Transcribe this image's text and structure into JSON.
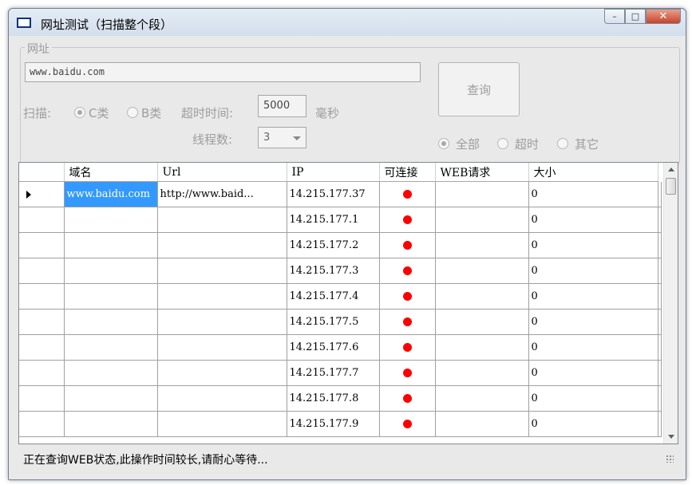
{
  "window": {
    "title": "网址测试（扫描整个段）",
    "buttons": {
      "minimize": "–",
      "maximize": "□",
      "close": "✕"
    }
  },
  "form": {
    "legend": "网址",
    "url_value": "www.baidu.com",
    "scan_label": "扫描:",
    "scan_options": [
      "C类",
      "B类"
    ],
    "scan_selected": "C类",
    "timeout_label": "超时时间:",
    "timeout_value": "5000",
    "timeout_unit": "毫秒",
    "threads_label": "线程数:",
    "threads_value": "3",
    "query_button": "查询",
    "filter_options": [
      "全部",
      "超时",
      "其它"
    ],
    "filter_selected": "全部"
  },
  "grid": {
    "columns": [
      "域名",
      "Url",
      "IP",
      "可连接",
      "WEB请求",
      "大小"
    ],
    "rows": [
      {
        "domain": "www.baidu.com",
        "url": "http://www.baid...",
        "ip": "14.215.177.37",
        "connectable": "red-dot",
        "web": "",
        "size": "0"
      },
      {
        "domain": "",
        "url": "",
        "ip": "14.215.177.1",
        "connectable": "red-dot",
        "web": "",
        "size": "0"
      },
      {
        "domain": "",
        "url": "",
        "ip": "14.215.177.2",
        "connectable": "red-dot",
        "web": "",
        "size": "0"
      },
      {
        "domain": "",
        "url": "",
        "ip": "14.215.177.3",
        "connectable": "red-dot",
        "web": "",
        "size": "0"
      },
      {
        "domain": "",
        "url": "",
        "ip": "14.215.177.4",
        "connectable": "red-dot",
        "web": "",
        "size": "0"
      },
      {
        "domain": "",
        "url": "",
        "ip": "14.215.177.5",
        "connectable": "red-dot",
        "web": "",
        "size": "0"
      },
      {
        "domain": "",
        "url": "",
        "ip": "14.215.177.6",
        "connectable": "red-dot",
        "web": "",
        "size": "0"
      },
      {
        "domain": "",
        "url": "",
        "ip": "14.215.177.7",
        "connectable": "red-dot",
        "web": "",
        "size": "0"
      },
      {
        "domain": "",
        "url": "",
        "ip": "14.215.177.8",
        "connectable": "red-dot",
        "web": "",
        "size": "0"
      },
      {
        "domain": "",
        "url": "",
        "ip": "14.215.177.9",
        "connectable": "red-dot",
        "web": "",
        "size": "0"
      }
    ]
  },
  "status": "正在查询WEB状态,此操作时间较长,请耐心等待...",
  "colors": {
    "selection": "#3399ff",
    "status_dot": "#ff0000",
    "disabled_text": "#9d9d9d"
  }
}
